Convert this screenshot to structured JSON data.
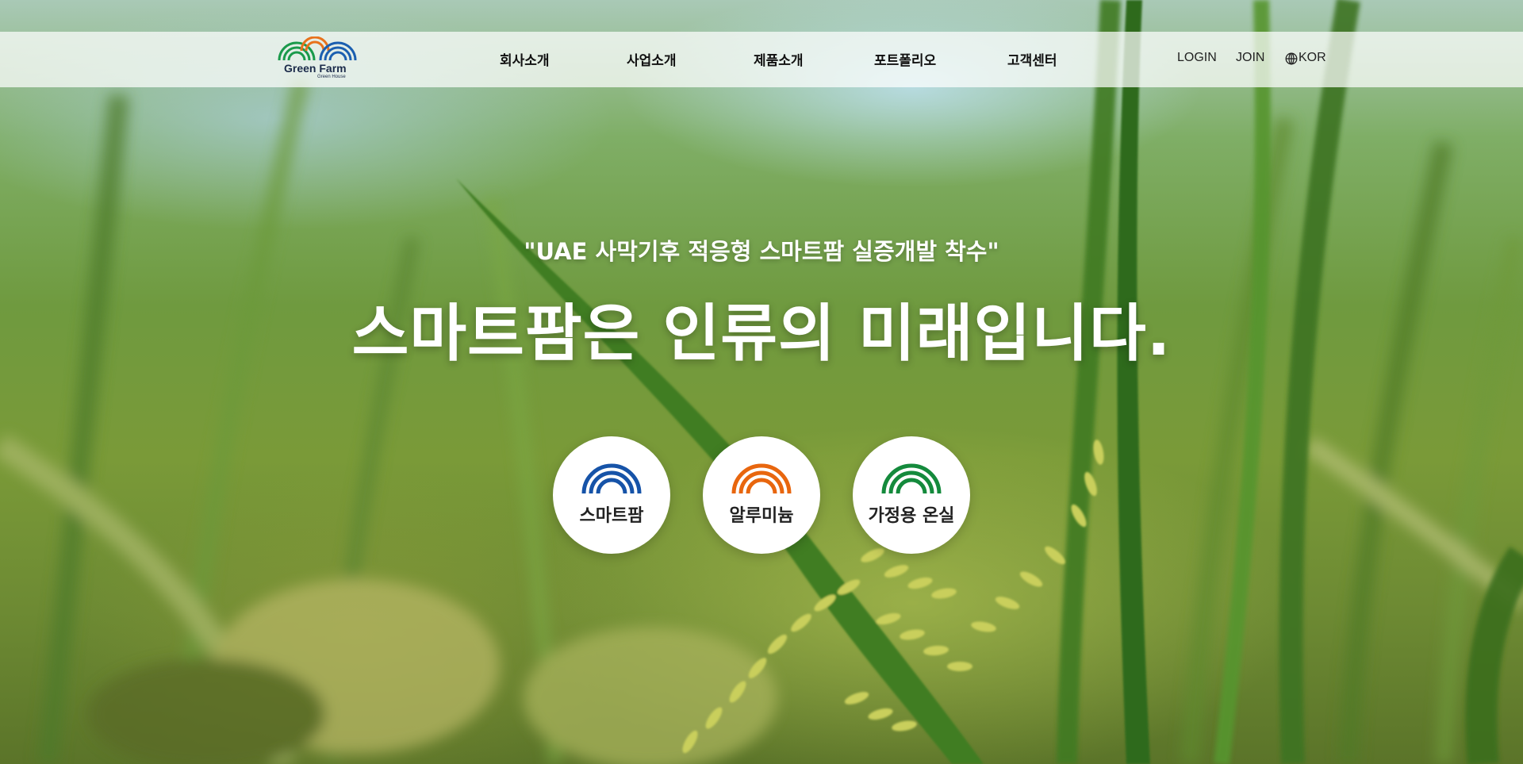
{
  "header": {
    "logo": {
      "name": "Green Farm",
      "subtitle": "Green House",
      "colors": [
        "#1a9a4b",
        "#e8721c",
        "#1b5fb0"
      ]
    },
    "nav": [
      {
        "label": "회사소개"
      },
      {
        "label": "사업소개"
      },
      {
        "label": "제품소개"
      },
      {
        "label": "포트폴리오"
      },
      {
        "label": "고객센터"
      }
    ],
    "login_label": "LOGIN",
    "join_label": "JOIN",
    "language_label": "KOR",
    "language_icon": "globe-icon"
  },
  "hero": {
    "subtitle": "\"UAE 사막기후 적응형 스마트팜 실증개발 착수\"",
    "headline": "스마트팜은 인류의 미래입니다.",
    "background": "rice-field-photo"
  },
  "categories": [
    {
      "label": "스마트팜",
      "color": "#1653a8",
      "icon": "rainbow-arc-icon"
    },
    {
      "label": "알루미늄",
      "color": "#e8660e",
      "icon": "rainbow-arc-icon"
    },
    {
      "label": "가정용 온실",
      "color": "#148a3c",
      "icon": "rainbow-arc-icon"
    }
  ]
}
